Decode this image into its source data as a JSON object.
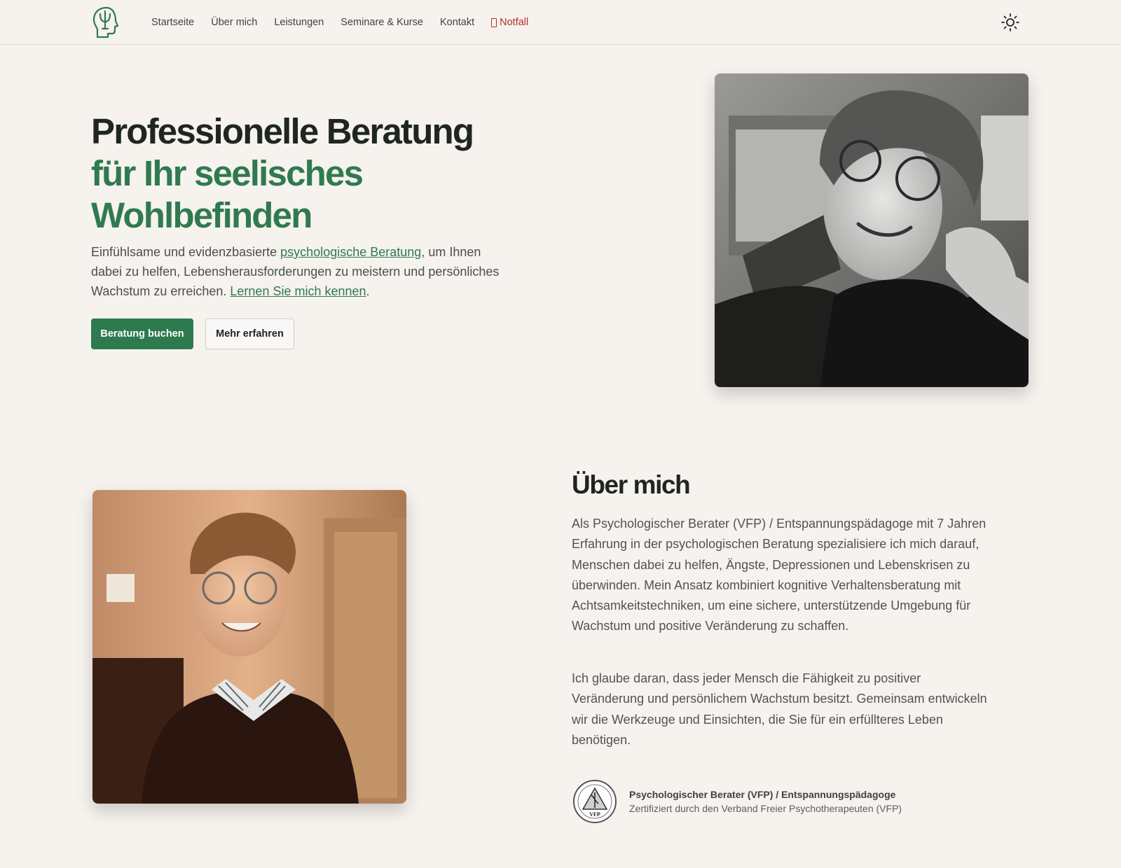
{
  "nav": {
    "links": [
      {
        "label": "Startseite"
      },
      {
        "label": "Über mich"
      },
      {
        "label": "Leistungen"
      },
      {
        "label": "Seminare & Kurse"
      },
      {
        "label": "Kontakt"
      }
    ],
    "emergency_label": "Notfall",
    "emergency_icon": "phone-icon",
    "logo_icon": "psi-head-icon",
    "theme_toggle_icon": "sun-icon"
  },
  "hero": {
    "title_line1": "Professionelle Beratung",
    "title_line2a": "für Ihr seelisches",
    "title_line2b": "Wohlbefinden",
    "text_before": "Einfühlsame und evidenzbasierte ",
    "text_link1": "psychologische Beratung",
    "text_middle": ", um Ihnen dabei zu helfen, Lebensherausforderungen zu meistern und persönliches Wachstum zu erreichen. ",
    "text_link2": "Lernen Sie mich kennen",
    "text_end": ".",
    "primary_button": "Beratung buchen",
    "secondary_button": "Mehr erfahren"
  },
  "about": {
    "title": "Über mich",
    "paragraph1": "Als Psychologischer Berater (VFP) / Entspannungspädagoge mit 7 Jahren Erfahrung in der psychologischen Beratung spezialisiere ich mich darauf, Menschen dabei zu helfen, Ängste, Depressionen und Lebenskrisen zu überwinden. Mein Ansatz kombiniert kognitive Verhaltensberatung mit Achtsamkeitstechniken, um eine sichere, unterstützende Umgebung für Wachstum und positive Veränderung zu schaffen.",
    "paragraph2": "Ich glaube daran, dass jeder Mensch die Fähigkeit zu positiver Veränderung und persönlichem Wachstum besitzt. Gemeinsam entwickeln wir die Werkzeuge und Einsichten, die Sie für ein erfüllteres Leben benötigen.",
    "cert_title": "Psychologischer Berater (VFP) / Entspannungspädagoge",
    "cert_subtitle": "Zertifiziert durch den Verband Freier Psychotherapeuten (VFP)",
    "cert_badge_text": "VFP"
  },
  "colors": {
    "accent_green": "#2f7a4f",
    "emergency_red": "#b3302a",
    "background": "#f6f2ee"
  }
}
